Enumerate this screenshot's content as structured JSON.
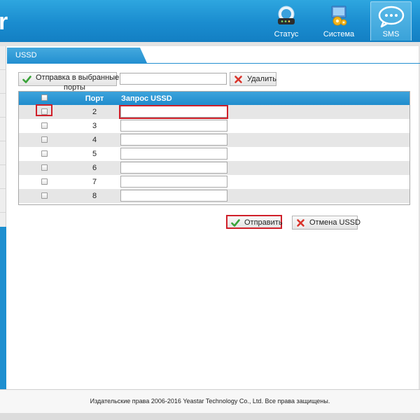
{
  "header": {
    "logo_fragment": "r",
    "nav": [
      {
        "label": "Статус",
        "icon": "router-status-icon"
      },
      {
        "label": "Система",
        "icon": "system-gear-icon"
      },
      {
        "label": "SMS",
        "icon": "sms-chat-icon",
        "active": true
      }
    ]
  },
  "section": {
    "title": "USSD"
  },
  "toolbar": {
    "send_selected_label_line1": "Отправка в выбранные",
    "send_selected_label_line2": "порты",
    "number_input_value": "",
    "delete_label": "Удалить"
  },
  "table": {
    "columns": [
      "Порт",
      "Запрос USSD"
    ],
    "rows": [
      {
        "port": "2",
        "request": "",
        "checked": false
      },
      {
        "port": "3",
        "request": "",
        "checked": false
      },
      {
        "port": "4",
        "request": "",
        "checked": false
      },
      {
        "port": "5",
        "request": "",
        "checked": false
      },
      {
        "port": "6",
        "request": "",
        "checked": false
      },
      {
        "port": "7",
        "request": "",
        "checked": false
      },
      {
        "port": "8",
        "request": "",
        "checked": false
      }
    ]
  },
  "actions": {
    "submit_label": "Отправить",
    "cancel_label": "Отмена USSD"
  },
  "footer": {
    "copyright": "Издательские права 2006-2016 Yeastar Technology Co., Ltd. Все права защищены."
  },
  "colors": {
    "header_blue": "#1a8ccf",
    "highlight_red": "#d0202a",
    "check_green": "#3aa339",
    "delete_red": "#d9342b"
  }
}
